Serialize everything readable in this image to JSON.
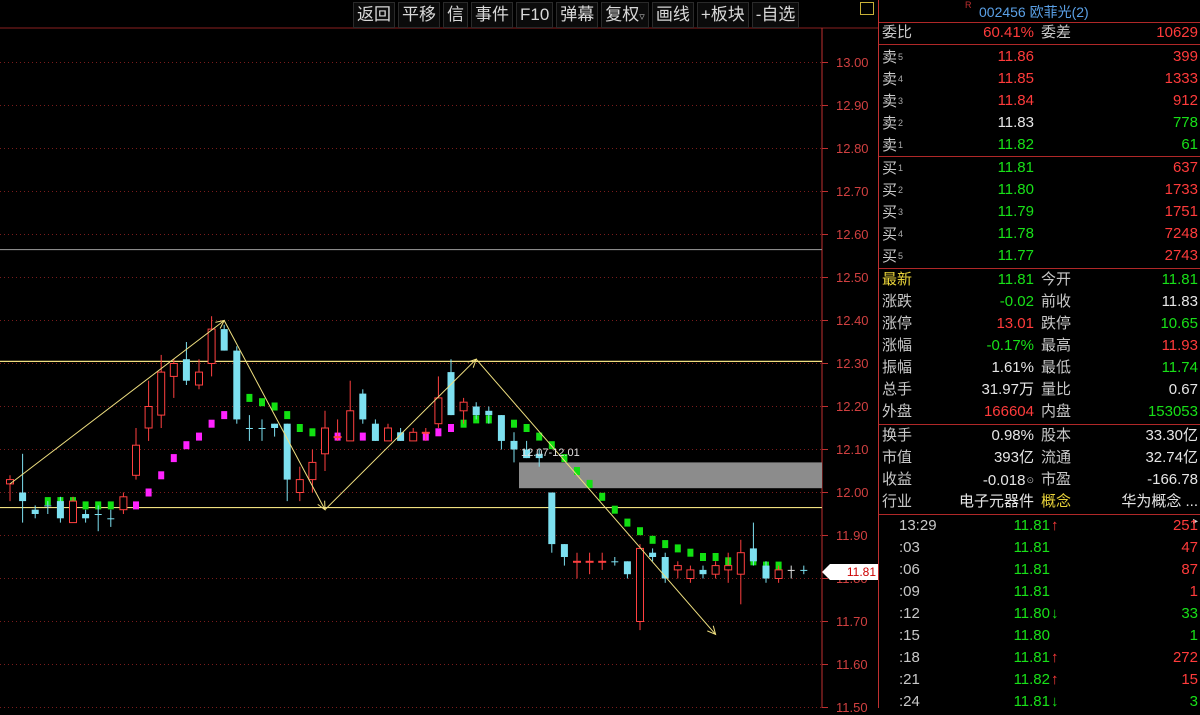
{
  "toolbar": {
    "buttons": [
      "返回",
      "平移",
      "信",
      "事件",
      "F10",
      "弹幕",
      "复权",
      "画线",
      "+板块",
      "-自选"
    ]
  },
  "chart_data": {
    "type": "candlestick",
    "y_ticks": [
      "13.00",
      "12.90",
      "12.80",
      "12.70",
      "12.60",
      "12.50",
      "12.40",
      "12.30",
      "12.20",
      "12.10",
      "12.00",
      "11.90",
      "11.80",
      "11.70",
      "11.60",
      "11.50"
    ],
    "ylim": [
      11.5,
      13.0
    ],
    "current_price_label": "11.81",
    "zone_label": "12.07-12.01",
    "zone": {
      "from": 12.01,
      "to": 12.07
    },
    "hlines": [
      {
        "value": 12.565,
        "color": "#8a8a8a"
      },
      {
        "value": 12.305,
        "color": "#f0e080"
      },
      {
        "value": 11.965,
        "color": "#f0e080"
      }
    ],
    "candles": [
      {
        "o": 12.02,
        "h": 12.04,
        "l": 11.98,
        "c": 12.03,
        "u": "red"
      },
      {
        "o": 11.98,
        "h": 12.09,
        "l": 11.93,
        "c": 12.0,
        "u": "cyan"
      },
      {
        "o": 11.96,
        "h": 11.97,
        "l": 11.94,
        "c": 11.95,
        "u": "cyan"
      },
      {
        "o": 11.97,
        "h": 11.98,
        "l": 11.95,
        "c": 11.97,
        "u": "cyan"
      },
      {
        "o": 11.98,
        "h": 11.99,
        "l": 11.93,
        "c": 11.94,
        "u": "cyan"
      },
      {
        "o": 11.93,
        "h": 11.99,
        "l": 11.93,
        "c": 11.98,
        "u": "red"
      },
      {
        "o": 11.95,
        "h": 11.96,
        "l": 11.93,
        "c": 11.94,
        "u": "cyan"
      },
      {
        "o": 11.95,
        "h": 11.97,
        "l": 11.91,
        "c": 11.95,
        "u": "cyan"
      },
      {
        "o": 11.94,
        "h": 11.96,
        "l": 11.92,
        "c": 11.94,
        "u": "cyan"
      },
      {
        "o": 11.96,
        "h": 12.0,
        "l": 11.95,
        "c": 11.99,
        "u": "red"
      },
      {
        "o": 12.04,
        "h": 12.15,
        "l": 12.03,
        "c": 12.11,
        "u": "red"
      },
      {
        "o": 12.15,
        "h": 12.26,
        "l": 12.12,
        "c": 12.2,
        "u": "red"
      },
      {
        "o": 12.18,
        "h": 12.32,
        "l": 12.15,
        "c": 12.28,
        "u": "red"
      },
      {
        "o": 12.27,
        "h": 12.31,
        "l": 12.22,
        "c": 12.3,
        "u": "red"
      },
      {
        "o": 12.31,
        "h": 12.35,
        "l": 12.25,
        "c": 12.26,
        "u": "cyan"
      },
      {
        "o": 12.25,
        "h": 12.31,
        "l": 12.24,
        "c": 12.28,
        "u": "red"
      },
      {
        "o": 12.3,
        "h": 12.41,
        "l": 12.27,
        "c": 12.38,
        "u": "red"
      },
      {
        "o": 12.38,
        "h": 12.39,
        "l": 12.33,
        "c": 12.33,
        "u": "cyan"
      },
      {
        "o": 12.33,
        "h": 12.34,
        "l": 12.16,
        "c": 12.17,
        "u": "cyan"
      },
      {
        "o": 12.15,
        "h": 12.18,
        "l": 12.12,
        "c": 12.15,
        "u": "cyan"
      },
      {
        "o": 12.15,
        "h": 12.17,
        "l": 12.12,
        "c": 12.15,
        "u": "cyan"
      },
      {
        "o": 12.16,
        "h": 12.16,
        "l": 12.13,
        "c": 12.15,
        "u": "cyan"
      },
      {
        "o": 12.16,
        "h": 12.16,
        "l": 11.98,
        "c": 12.03,
        "u": "cyan"
      },
      {
        "o": 12.0,
        "h": 12.06,
        "l": 11.98,
        "c": 12.03,
        "u": "red"
      },
      {
        "o": 12.03,
        "h": 12.1,
        "l": 12.0,
        "c": 12.07,
        "u": "red"
      },
      {
        "o": 12.09,
        "h": 12.19,
        "l": 12.05,
        "c": 12.15,
        "u": "red"
      },
      {
        "o": 12.13,
        "h": 12.17,
        "l": 12.12,
        "c": 12.13,
        "u": "red"
      },
      {
        "o": 12.12,
        "h": 12.26,
        "l": 12.12,
        "c": 12.19,
        "u": "red"
      },
      {
        "o": 12.23,
        "h": 12.24,
        "l": 12.16,
        "c": 12.17,
        "u": "cyan"
      },
      {
        "o": 12.16,
        "h": 12.17,
        "l": 12.12,
        "c": 12.12,
        "u": "cyan"
      },
      {
        "o": 12.12,
        "h": 12.16,
        "l": 12.12,
        "c": 12.15,
        "u": "red"
      },
      {
        "o": 12.14,
        "h": 12.15,
        "l": 12.12,
        "c": 12.12,
        "u": "cyan"
      },
      {
        "o": 12.12,
        "h": 12.15,
        "l": 12.12,
        "c": 12.14,
        "u": "red"
      },
      {
        "o": 12.14,
        "h": 12.15,
        "l": 12.12,
        "c": 12.14,
        "u": "red"
      },
      {
        "o": 12.16,
        "h": 12.27,
        "l": 12.15,
        "c": 12.22,
        "u": "red"
      },
      {
        "o": 12.28,
        "h": 12.31,
        "l": 12.18,
        "c": 12.18,
        "u": "cyan"
      },
      {
        "o": 12.19,
        "h": 12.22,
        "l": 12.16,
        "c": 12.21,
        "u": "red"
      },
      {
        "o": 12.2,
        "h": 12.21,
        "l": 12.17,
        "c": 12.18,
        "u": "cyan"
      },
      {
        "o": 12.19,
        "h": 12.2,
        "l": 12.16,
        "c": 12.18,
        "u": "cyan"
      },
      {
        "o": 12.18,
        "h": 12.18,
        "l": 12.1,
        "c": 12.12,
        "u": "cyan"
      },
      {
        "o": 12.12,
        "h": 12.14,
        "l": 12.07,
        "c": 12.1,
        "u": "cyan"
      },
      {
        "o": 12.1,
        "h": 12.12,
        "l": 12.08,
        "c": 12.08,
        "u": "cyan"
      },
      {
        "o": 12.09,
        "h": 12.1,
        "l": 12.06,
        "c": 12.08,
        "u": "cyan"
      },
      {
        "o": 12.0,
        "h": 12.0,
        "l": 11.86,
        "c": 11.88,
        "u": "cyan"
      },
      {
        "o": 11.88,
        "h": 11.88,
        "l": 11.83,
        "c": 11.85,
        "u": "cyan"
      },
      {
        "o": 11.84,
        "h": 11.86,
        "l": 11.8,
        "c": 11.84,
        "u": "red"
      },
      {
        "o": 11.84,
        "h": 11.86,
        "l": 11.81,
        "c": 11.84,
        "u": "red"
      },
      {
        "o": 11.84,
        "h": 11.86,
        "l": 11.82,
        "c": 11.84,
        "u": "red"
      },
      {
        "o": 11.84,
        "h": 11.85,
        "l": 11.83,
        "c": 11.84,
        "u": "cyan"
      },
      {
        "o": 11.84,
        "h": 11.84,
        "l": 11.8,
        "c": 11.81,
        "u": "cyan"
      },
      {
        "o": 11.7,
        "h": 11.88,
        "l": 11.68,
        "c": 11.87,
        "u": "red"
      },
      {
        "o": 11.86,
        "h": 11.87,
        "l": 11.84,
        "c": 11.85,
        "u": "cyan"
      },
      {
        "o": 11.85,
        "h": 11.86,
        "l": 11.79,
        "c": 11.8,
        "u": "cyan"
      },
      {
        "o": 11.82,
        "h": 11.84,
        "l": 11.8,
        "c": 11.83,
        "u": "red"
      },
      {
        "o": 11.8,
        "h": 11.83,
        "l": 11.79,
        "c": 11.82,
        "u": "red"
      },
      {
        "o": 11.82,
        "h": 11.83,
        "l": 11.8,
        "c": 11.81,
        "u": "cyan"
      },
      {
        "o": 11.81,
        "h": 11.84,
        "l": 11.8,
        "c": 11.83,
        "u": "red"
      },
      {
        "o": 11.82,
        "h": 11.86,
        "l": 11.79,
        "c": 11.83,
        "u": "red"
      },
      {
        "o": 11.81,
        "h": 11.89,
        "l": 11.74,
        "c": 11.86,
        "u": "red"
      },
      {
        "o": 11.87,
        "h": 11.93,
        "l": 11.83,
        "c": 11.84,
        "u": "cyan"
      },
      {
        "o": 11.83,
        "h": 11.84,
        "l": 11.79,
        "c": 11.8,
        "u": "cyan"
      },
      {
        "o": 11.8,
        "h": 11.83,
        "l": 11.79,
        "c": 11.82,
        "u": "red"
      },
      {
        "o": 11.82,
        "h": 11.83,
        "l": 11.8,
        "c": 11.82,
        "u": "white"
      },
      {
        "o": 11.82,
        "h": 11.83,
        "l": 11.81,
        "c": 11.82,
        "u": "cyan"
      }
    ],
    "ma_dots": [
      [
        3,
        11.98,
        "g"
      ],
      [
        4,
        11.98,
        "g"
      ],
      [
        5,
        11.98,
        "g"
      ],
      [
        6,
        11.97,
        "g"
      ],
      [
        7,
        11.97,
        "g"
      ],
      [
        8,
        11.97,
        "g"
      ],
      [
        9,
        11.97,
        "g"
      ],
      [
        10,
        11.97,
        "m"
      ],
      [
        11,
        12.0,
        "m"
      ],
      [
        12,
        12.04,
        "m"
      ],
      [
        13,
        12.08,
        "m"
      ],
      [
        14,
        12.11,
        "m"
      ],
      [
        15,
        12.13,
        "m"
      ],
      [
        16,
        12.16,
        "m"
      ],
      [
        17,
        12.18,
        "m"
      ],
      [
        18,
        12.21,
        "m"
      ],
      [
        19,
        12.22,
        "g"
      ],
      [
        20,
        12.21,
        "g"
      ],
      [
        21,
        12.2,
        "g"
      ],
      [
        22,
        12.18,
        "g"
      ],
      [
        23,
        12.15,
        "g"
      ],
      [
        24,
        12.14,
        "g"
      ],
      [
        25,
        12.13,
        "m"
      ],
      [
        26,
        12.13,
        "m"
      ],
      [
        27,
        12.13,
        "m"
      ],
      [
        28,
        12.13,
        "m"
      ],
      [
        29,
        12.14,
        "m"
      ],
      [
        30,
        12.13,
        "m"
      ],
      [
        31,
        12.13,
        "m"
      ],
      [
        32,
        12.13,
        "m"
      ],
      [
        33,
        12.13,
        "m"
      ],
      [
        34,
        12.14,
        "m"
      ],
      [
        35,
        12.15,
        "m"
      ],
      [
        36,
        12.16,
        "g"
      ],
      [
        37,
        12.17,
        "g"
      ],
      [
        38,
        12.17,
        "g"
      ],
      [
        39,
        12.17,
        "g"
      ],
      [
        40,
        12.16,
        "g"
      ],
      [
        41,
        12.15,
        "g"
      ],
      [
        42,
        12.13,
        "g"
      ],
      [
        43,
        12.11,
        "g"
      ],
      [
        44,
        12.08,
        "g"
      ],
      [
        45,
        12.05,
        "g"
      ],
      [
        46,
        12.02,
        "g"
      ],
      [
        47,
        11.99,
        "g"
      ],
      [
        48,
        11.96,
        "g"
      ],
      [
        49,
        11.93,
        "g"
      ],
      [
        50,
        11.91,
        "g"
      ],
      [
        51,
        11.89,
        "g"
      ],
      [
        52,
        11.88,
        "g"
      ],
      [
        53,
        11.87,
        "g"
      ],
      [
        54,
        11.86,
        "g"
      ],
      [
        55,
        11.85,
        "g"
      ],
      [
        56,
        11.85,
        "g"
      ],
      [
        57,
        11.84,
        "g"
      ],
      [
        58,
        11.84,
        "g"
      ],
      [
        59,
        11.84,
        "g"
      ],
      [
        60,
        11.83,
        "g"
      ],
      [
        61,
        11.83,
        "g"
      ]
    ],
    "zigzag": [
      [
        0,
        12.02
      ],
      [
        17,
        12.4
      ],
      [
        25,
        11.96
      ],
      [
        37,
        12.31
      ],
      [
        56,
        11.67
      ]
    ]
  },
  "quote": {
    "code_name": "002456 欧菲光(2)",
    "r_mark": "R",
    "ratio_label": "委比",
    "ratio_value": "60.41%",
    "diff_label": "委差",
    "diff_value": "10629",
    "sells": [
      {
        "label": "卖",
        "n": "5",
        "price": "11.86",
        "vol": "399",
        "color": "red"
      },
      {
        "label": "卖",
        "n": "4",
        "price": "11.85",
        "vol": "1333",
        "color": "red"
      },
      {
        "label": "卖",
        "n": "3",
        "price": "11.84",
        "vol": "912",
        "color": "red"
      },
      {
        "label": "卖",
        "n": "2",
        "price": "11.83",
        "vol": "778",
        "color": "white"
      },
      {
        "label": "卖",
        "n": "1",
        "price": "11.82",
        "vol": "61",
        "color": "green"
      }
    ],
    "buys": [
      {
        "label": "买",
        "n": "1",
        "price": "11.81",
        "vol": "637",
        "color": "green"
      },
      {
        "label": "买",
        "n": "2",
        "price": "11.80",
        "vol": "1733",
        "color": "green"
      },
      {
        "label": "买",
        "n": "3",
        "price": "11.79",
        "vol": "1751",
        "color": "green"
      },
      {
        "label": "买",
        "n": "4",
        "price": "11.78",
        "vol": "7248",
        "color": "green"
      },
      {
        "label": "买",
        "n": "5",
        "price": "11.77",
        "vol": "2743",
        "color": "green"
      }
    ],
    "stats": [
      {
        "l1": "最新",
        "v1": "11.81",
        "c1": "green",
        "l2": "今开",
        "v2": "11.81",
        "c2": "green",
        "l1c": "yellow"
      },
      {
        "l1": "涨跌",
        "v1": "-0.02",
        "c1": "green",
        "l2": "前收",
        "v2": "11.83",
        "c2": "white"
      },
      {
        "l1": "涨停",
        "v1": "13.01",
        "c1": "red",
        "l2": "跌停",
        "v2": "10.65",
        "c2": "green"
      },
      {
        "l1": "涨幅",
        "v1": "-0.17%",
        "c1": "green",
        "l2": "最高",
        "v2": "11.93",
        "c2": "red"
      },
      {
        "l1": "振幅",
        "v1": "1.61%",
        "c1": "white",
        "l2": "最低",
        "v2": "11.74",
        "c2": "green"
      },
      {
        "l1": "总手",
        "v1": "31.97万",
        "c1": "white",
        "l2": "量比",
        "v2": "0.67",
        "c2": "white"
      },
      {
        "l1": "外盘",
        "v1": "166604",
        "c1": "red",
        "l2": "内盘",
        "v2": "153053",
        "c2": "green"
      }
    ],
    "fundamentals": [
      {
        "l1": "换手",
        "v1": "0.98%",
        "l2": "股本",
        "v2": "33.30亿"
      },
      {
        "l1": "市值",
        "v1": "393亿",
        "l2": "流通",
        "v2": "32.74亿"
      },
      {
        "l1": "收益",
        "v1": "-0.018",
        "v1_mark": "⊙",
        "l2": "市盈",
        "v2": "-166.78"
      },
      {
        "l1": "行业",
        "v1": "电子元器件",
        "l2": "概念",
        "v2": "华为概念 ...",
        "l2c": "yellow"
      }
    ],
    "ticks": [
      {
        "time": "13:29",
        "price": "11.81",
        "arrow": "↑",
        "vol": "251",
        "pc": "green",
        "ac": "red",
        "vc": "red"
      },
      {
        "time": ":03",
        "price": "11.81",
        "arrow": "",
        "vol": "47",
        "pc": "green",
        "ac": "",
        "vc": "red"
      },
      {
        "time": ":06",
        "price": "11.81",
        "arrow": "",
        "vol": "87",
        "pc": "green",
        "ac": "",
        "vc": "red"
      },
      {
        "time": ":09",
        "price": "11.81",
        "arrow": "",
        "vol": "1",
        "pc": "green",
        "ac": "",
        "vc": "red"
      },
      {
        "time": ":12",
        "price": "11.80",
        "arrow": "↓",
        "vol": "33",
        "pc": "green",
        "ac": "green",
        "vc": "green"
      },
      {
        "time": ":15",
        "price": "11.80",
        "arrow": "",
        "vol": "1",
        "pc": "green",
        "ac": "",
        "vc": "green"
      },
      {
        "time": ":18",
        "price": "11.81",
        "arrow": "↑",
        "vol": "272",
        "pc": "green",
        "ac": "red",
        "vc": "red"
      },
      {
        "time": ":21",
        "price": "11.82",
        "arrow": "↑",
        "vol": "15",
        "pc": "green",
        "ac": "red",
        "vc": "red"
      },
      {
        "time": ":24",
        "price": "11.81",
        "arrow": "↓",
        "vol": "3",
        "pc": "green",
        "ac": "green",
        "vc": "green"
      }
    ]
  }
}
